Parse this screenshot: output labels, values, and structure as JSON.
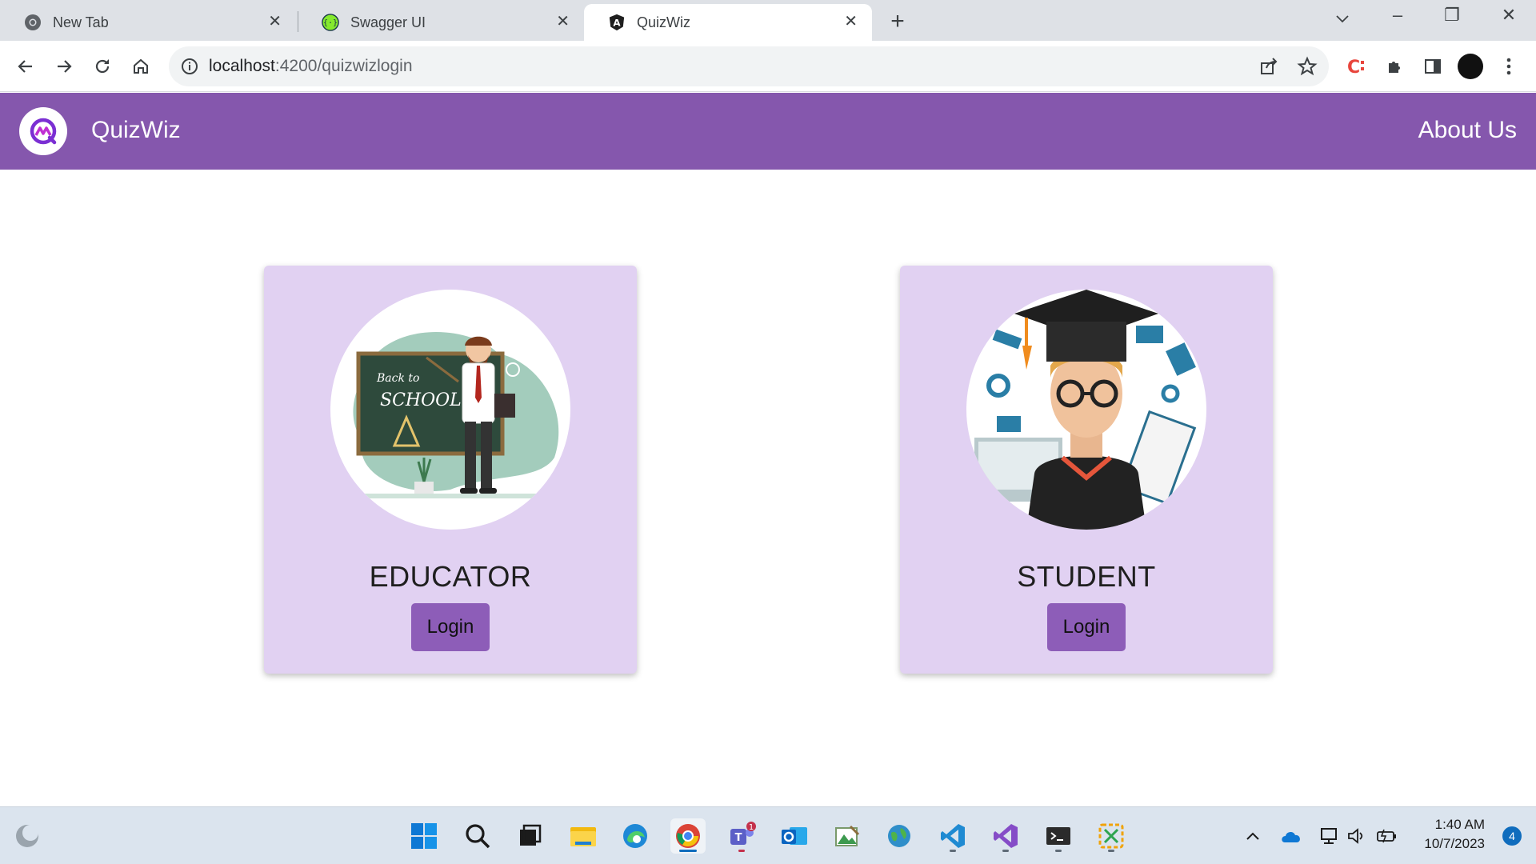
{
  "browser": {
    "tabs": [
      {
        "label": "New Tab",
        "icon": "chrome-icon",
        "active": false
      },
      {
        "label": "Swagger UI",
        "icon": "swagger-icon",
        "active": false
      },
      {
        "label": "QuizWiz",
        "icon": "angular-icon",
        "active": true
      }
    ],
    "url_host": "localhost",
    "url_path": ":4200/quizwizlogin"
  },
  "app": {
    "name": "QuizWiz",
    "about_label": "About Us",
    "brand_color": "#8557ad",
    "card_color": "#e1d1f2",
    "button_color": "#8d5db8"
  },
  "cards": [
    {
      "title": "EDUCATOR",
      "login_label": "Login",
      "image": "teacher-illustration"
    },
    {
      "title": "STUDENT",
      "login_label": "Login",
      "image": "graduate-student-illustration"
    }
  ],
  "taskbar": {
    "time": "1:40 AM",
    "date": "10/7/2023",
    "notification_count": "4",
    "teams_badge": "1"
  }
}
